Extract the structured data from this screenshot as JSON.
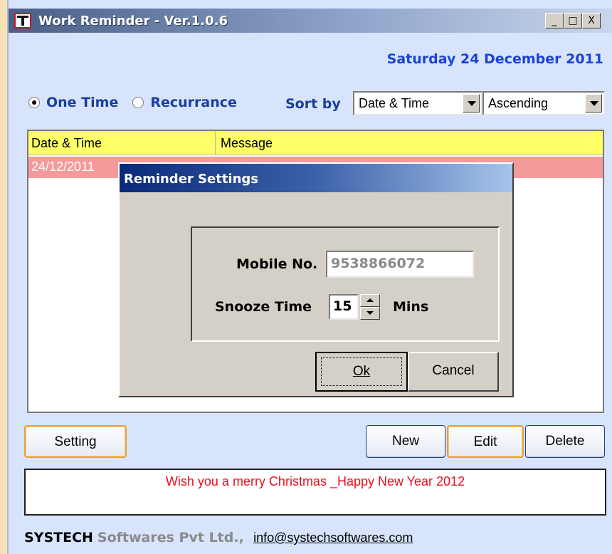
{
  "window": {
    "title": "Work Reminder - Ver.1.0.6",
    "controls": {
      "minimize": "_",
      "maximize": "□",
      "close": "X"
    }
  },
  "header": {
    "date": "Saturday 24 December 2011"
  },
  "filters": {
    "one_time_label": "One Time",
    "recurrence_label": "Recurrance",
    "selected": "one_time",
    "sort_by_label": "Sort by",
    "sort_field": "Date & Time",
    "sort_order": "Ascending"
  },
  "grid": {
    "columns": [
      "Date & Time",
      "Message"
    ],
    "rows": [
      {
        "date": "24/12/2011"
      }
    ]
  },
  "dialog": {
    "title": "Reminder Settings",
    "mobile_label": "Mobile No.",
    "mobile_value": "9538866072",
    "snooze_label": "Snooze Time",
    "snooze_value": "15",
    "snooze_unit": "Mins",
    "ok_label": "Ok",
    "cancel_label": "Cancel"
  },
  "actions": {
    "setting_label": "Setting",
    "new_label": "New",
    "edit_label": "Edit",
    "delete_label": "Delete"
  },
  "message": "Wish you a merry Christmas _Happy New Year 2012",
  "footer": {
    "brand": "SYSTECH",
    "softwares": "Softwares Pvt Ltd.,",
    "email": "info@systechsoftwares.com"
  }
}
